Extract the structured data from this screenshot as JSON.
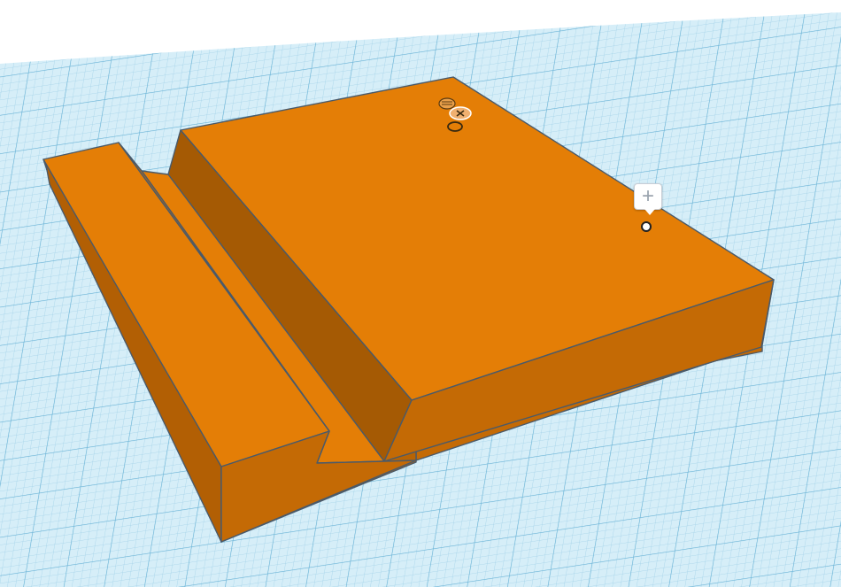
{
  "scene": {
    "workplane_color": "#d6eef8",
    "grid_minor_color": "#9fd0e8",
    "grid_major_color": "#69b3d6",
    "object_top_color": "#e47e06",
    "object_side_color": "#c46a05",
    "object_dark_color": "#a55a04",
    "edge_color": "#4a5a6a"
  },
  "icons": {
    "add_marker": "plus-icon",
    "ruler_handle": "ruler-icon",
    "close_handle": "close-icon",
    "height_handle": "ring-icon",
    "marker_point": "circle-icon"
  },
  "add_marker": {
    "glyph": "+"
  }
}
